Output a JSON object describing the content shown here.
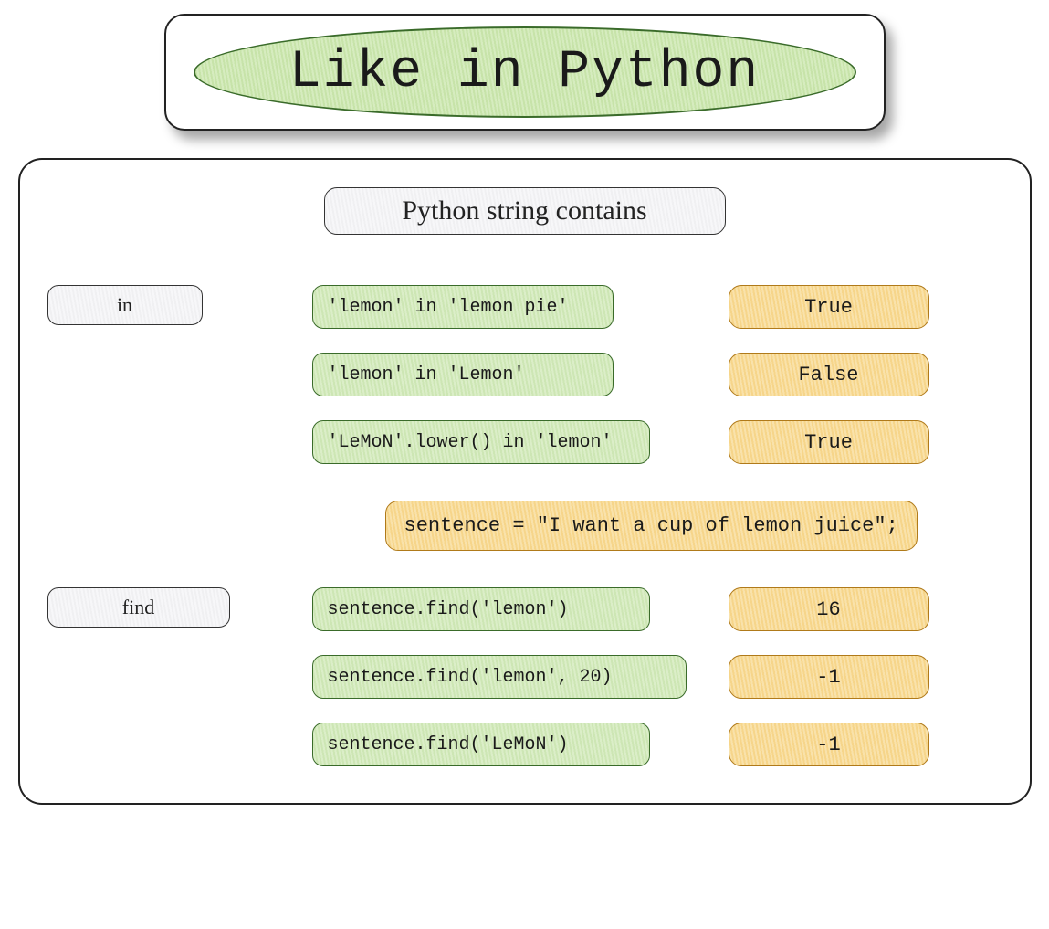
{
  "header": {
    "title": "Like in Python"
  },
  "subtitle": "Python string contains",
  "sections": {
    "in": {
      "label": "in",
      "rows": [
        {
          "code": "'lemon' in 'lemon pie'",
          "result": "True"
        },
        {
          "code": "'lemon' in 'Lemon'",
          "result": "False"
        },
        {
          "code": "'LeMoN'.lower() in 'lemon'",
          "result": "True"
        }
      ]
    },
    "sentence": "sentence = \"I want a cup of lemon juice\";",
    "find": {
      "label": "find",
      "rows": [
        {
          "code": "sentence.find('lemon')",
          "result": "16"
        },
        {
          "code": "sentence.find('lemon', 20)",
          "result": "-1"
        },
        {
          "code": "sentence.find('LeMoN')",
          "result": "-1"
        }
      ]
    }
  },
  "colors": {
    "green_fill": "#cde6b4",
    "green_border": "#3a6b2a",
    "orange_fill": "#f6d58a",
    "orange_border": "#b07a1a",
    "grey_fill": "#f0f0f2"
  }
}
